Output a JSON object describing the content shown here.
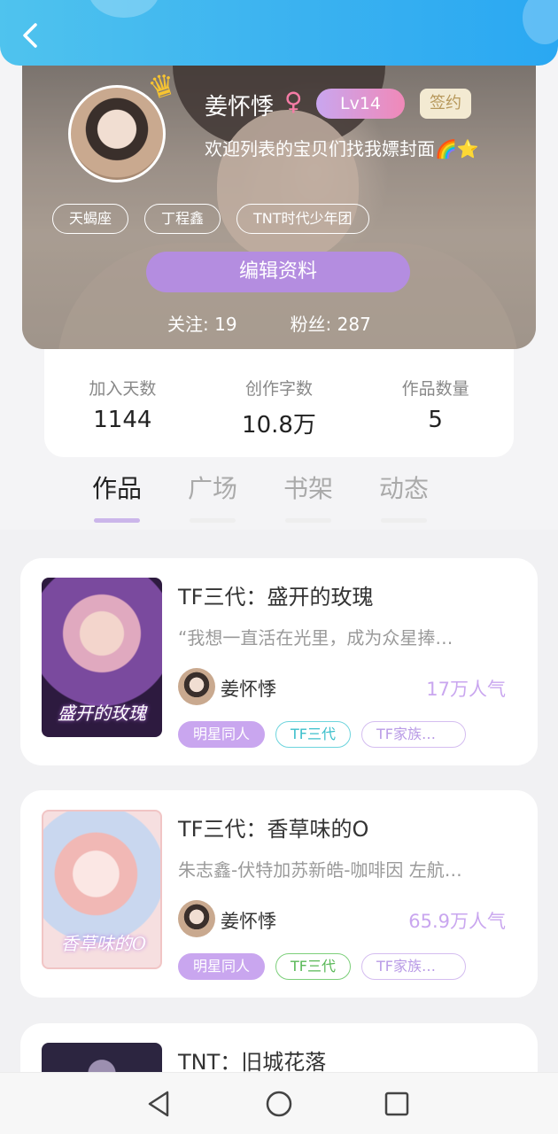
{
  "profile": {
    "nickname": "姜怀悸",
    "gender_symbol": "♀",
    "level": "Lv14",
    "sign_badge": "签约",
    "intro": "欢迎列表的宝贝们找我嫖封面🌈⭐",
    "tags": [
      "天蝎座",
      "丁程鑫",
      "TNT时代少年团"
    ],
    "edit_button": "编辑资料",
    "follow_label": "关注:",
    "follow_count": "19",
    "fans_label": "粉丝:",
    "fans_count": "287"
  },
  "stats": [
    {
      "label": "加入天数",
      "value": "1144"
    },
    {
      "label": "创作字数",
      "value": "10.8万"
    },
    {
      "label": "作品数量",
      "value": "5"
    }
  ],
  "tabs": [
    "作品",
    "广场",
    "书架",
    "动态"
  ],
  "works": [
    {
      "title": "TF三代：盛开的玫瑰",
      "desc": "“我想一直活在光里，成为众星捧…",
      "author": "姜怀悸",
      "heat": "17万人气",
      "cover_text": "盛开的玫瑰",
      "tags": [
        "明星同人",
        "TF三代",
        "TF家族…"
      ]
    },
    {
      "title": "TF三代：香草味的O",
      "desc": "朱志鑫-伏特加苏新皓-咖啡因 左航…",
      "author": "姜怀悸",
      "heat": "65.9万人气",
      "cover_text": "香草味的O",
      "tags": [
        "明星同人",
        "TF三代",
        "TF家族…"
      ]
    },
    {
      "title": "TNT：旧城花落"
    }
  ],
  "colors": {
    "topbar": "#3cb3f0",
    "accent_purple": "#c9a6ef",
    "edit_button": "#b48de0"
  },
  "icons": {
    "back": "back-arrow-icon",
    "crown": "crown-icon",
    "nav_back": "triangle-back-icon",
    "nav_home": "circle-home-icon",
    "nav_recent": "square-recent-icon"
  }
}
